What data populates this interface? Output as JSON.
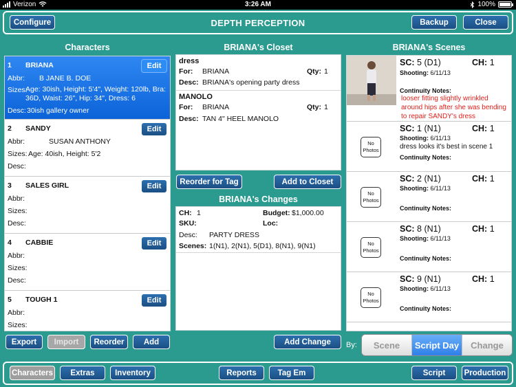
{
  "status": {
    "carrier": "Verizon",
    "time": "3:26 AM",
    "battery": "100%"
  },
  "header": {
    "title": "DEPTH PERCEPTION",
    "configure": "Configure",
    "backup": "Backup",
    "close": "Close"
  },
  "characters": {
    "title": "Characters",
    "items": [
      {
        "num": "1",
        "name": "BRIANA",
        "abbr": "B  JANE B. DOE",
        "sizes": "Age: 30ish, Height: 5'4\", Weight: 120lb, Bra: 36D, Waist: 26\", Hip: 34\", Dress: 6",
        "desc": "30ish gallery owner"
      },
      {
        "num": "2",
        "name": "SANDY",
        "abbr": "SUSAN ANTHONY",
        "sizes": "Age: 40ish, Height: 5'2",
        "desc": ""
      },
      {
        "num": "3",
        "name": "SALES GIRL",
        "abbr": "",
        "sizes": "",
        "desc": ""
      },
      {
        "num": "4",
        "name": "CABBIE",
        "abbr": "",
        "sizes": "",
        "desc": ""
      },
      {
        "num": "5",
        "name": "TOUGH 1",
        "abbr": "",
        "sizes": "",
        "desc": ""
      }
    ],
    "labels": {
      "abbr": "Abbr:",
      "sizes": "Sizes:",
      "desc": "Desc:",
      "edit": "Edit"
    },
    "buttons": {
      "export": "Export",
      "import": "Import",
      "reorder": "Reorder",
      "add": "Add"
    }
  },
  "closet": {
    "title": "BRIANA's Closet",
    "labels": {
      "for": "For:",
      "qty": "Qty:",
      "desc": "Desc:"
    },
    "items": [
      {
        "name": "dress",
        "for": "BRIANA",
        "qty": "1",
        "desc": "BRIANA's opening party dress"
      },
      {
        "name": "MANOLO",
        "for": "BRIANA",
        "qty": "1",
        "desc": "TAN 4\" HEEL MANOLO"
      }
    ],
    "reorder_button": "Reorder for Tag",
    "add_button": "Add to Closet"
  },
  "changes": {
    "title": "BRIANA's Changes",
    "ch_label": "CH:",
    "ch": "1",
    "budget_label": "Budget:",
    "budget": "$1,000.00",
    "sku_label": "SKU:",
    "loc_label": "Loc:",
    "desc_label": "Desc:",
    "desc": "PARTY DRESS",
    "scenes_label": "Scenes:",
    "scenes": "1(N1), 2(N1), 5(D1), 8(N1), 9(N1)",
    "add_button": "Add Change"
  },
  "scenes": {
    "title": "BRIANA's Scenes",
    "sc_label": "SC:",
    "ch_label": "CH:",
    "shooting_label": "Shooting:",
    "continuity_label": "Continuity Notes:",
    "no_photos": [
      "No",
      "Photos"
    ],
    "items": [
      {
        "sc": "5 (D1)",
        "ch": "1",
        "shooting": "6/11/13",
        "note": "",
        "continuity": "looser fitting slightly wrinkled around hips after she was bending to repair SANDY's dress"
      },
      {
        "sc": "1 (N1)",
        "ch": "1",
        "shooting": "6/11/13",
        "note": "dress looks it's best in scene 1",
        "continuity": ""
      },
      {
        "sc": "2 (N1)",
        "ch": "1",
        "shooting": "6/11/13",
        "note": "",
        "continuity": ""
      },
      {
        "sc": "8 (N1)",
        "ch": "1",
        "shooting": "6/11/13",
        "note": "",
        "continuity": ""
      },
      {
        "sc": "9 (N1)",
        "ch": "1",
        "shooting": "6/11/13",
        "note": "",
        "continuity": ""
      }
    ]
  },
  "sort": {
    "by_label": "By:",
    "options": [
      "Scene",
      "Script Day",
      "Change"
    ],
    "selected": "Script Day"
  },
  "footer": {
    "characters": "Characters",
    "extras": "Extras",
    "inventory": "Inventory",
    "reports": "Reports",
    "tag_em": "Tag Em",
    "script": "Script",
    "production": "Production"
  },
  "colors": {
    "background": "#2b9a8f",
    "button": "#1b4f84",
    "selected_row": "#0b63d8",
    "note_red": "#e0201b"
  }
}
